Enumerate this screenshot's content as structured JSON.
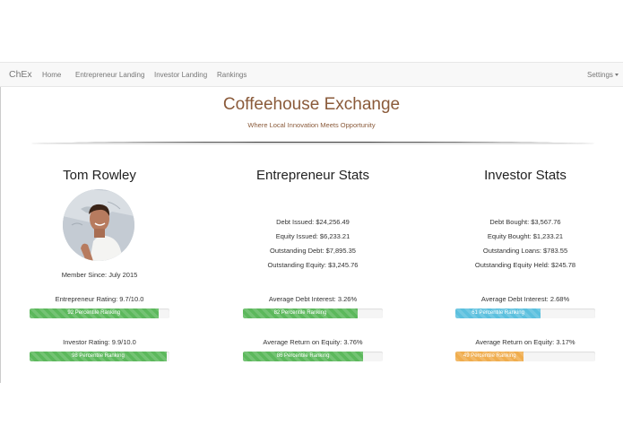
{
  "navbar": {
    "brand": "ChEx",
    "links": [
      "Home",
      "Entrepreneur Landing",
      "Investor Landing",
      "Rankings"
    ],
    "settings": "Settings"
  },
  "header": {
    "title": "Coffeehouse Exchange",
    "subtitle": "Where Local Innovation Meets Opportunity"
  },
  "profile": {
    "name": "Tom Rowley",
    "member_since": "Member Since: July 2015",
    "entrepreneur_rating": "Entrepreneur Rating: 9.7/10.0",
    "entrepreneur_bar": {
      "label": "92 Percentile Ranking",
      "percent": 92,
      "color": "#5cb85c"
    },
    "investor_rating": "Investor Rating: 9.9/10.0",
    "investor_bar": {
      "label": "98 Percentile Ranking",
      "percent": 98,
      "color": "#5cb85c"
    }
  },
  "entrepreneur_stats": {
    "heading": "Entrepreneur Stats",
    "lines": [
      "Debt Issued: $24,256.49",
      "Equity Issued: $6,233.21",
      "Outstanding Debt: $7,895.35",
      "Outstanding Equity: $3,245.76"
    ],
    "avg_debt_interest": "Average Debt Interest: 3.26%",
    "debt_bar": {
      "label": "82 Percentile Ranking",
      "percent": 82,
      "color": "#5cb85c"
    },
    "avg_return_equity": "Average Return on Equity: 3.76%",
    "equity_bar": {
      "label": "86 Percentile Ranking",
      "percent": 86,
      "color": "#5cb85c"
    }
  },
  "investor_stats": {
    "heading": "Investor Stats",
    "lines": [
      "Debt Bought: $3,567.76",
      "Equity Bought: $1,233.21",
      "Outstanding Loans: $783.55",
      "Outstanding Equity Held: $245.78"
    ],
    "avg_debt_interest": "Average Debt Interest: 2.68%",
    "debt_bar": {
      "label": "61 Percentile Ranking",
      "percent": 61,
      "color": "#5bc0de"
    },
    "avg_return_equity": "Average Return on Equity: 3.17%",
    "equity_bar": {
      "label": "49 Percentile Ranking",
      "percent": 49,
      "color": "#f0ad4e"
    }
  }
}
